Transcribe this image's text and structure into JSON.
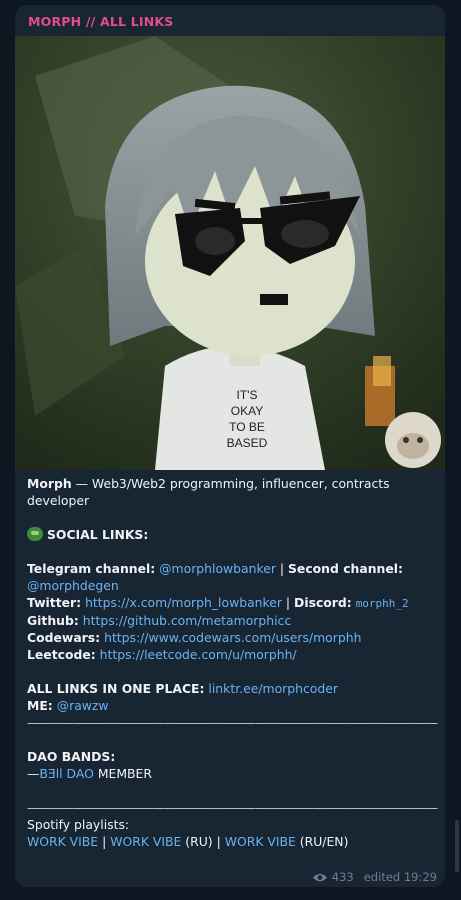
{
  "post": {
    "channel_title": "MORPH // ALL LINKS",
    "image_shirt_lines": [
      "IT'S",
      "OKAY",
      "TO BE",
      "BASED"
    ],
    "intro_name": "Morph",
    "intro_text": " — Web3/Web2 programming, influencer, contracts developer",
    "social_header": "SOCIAL LINKS:",
    "telegram_label": "Telegram channel:",
    "telegram_handle": "@morphlowbanker",
    "sep": " | ",
    "second_label": "Second channel:",
    "second_handle": "@morphdegen",
    "twitter_label": "Twitter:",
    "twitter_url": "https://x.com/morph_lowbanker",
    "discord_label": "Discord:",
    "discord_handle": "morphh_2",
    "github_label": "Github:",
    "github_url": "https://github.com/metamorphicc",
    "codewars_label": "Codewars:",
    "codewars_url": "https://www.codewars.com/users/morphh",
    "leetcode_label": "Leetcode:",
    "leetcode_url": "https://leetcode.com/u/morphh/",
    "all_links_label": "ALL LINKS IN ONE PLACE:",
    "all_links_url": "linktr.ee/morphcoder",
    "me_label": "ME:",
    "me_handle": "@rawzw",
    "divider": "————————————————————————————————————",
    "dao_label": "DAO BANDS:",
    "dao_prefix": "—",
    "dao_link": "BƎll DAO",
    "dao_suffix": " MEMBER",
    "spotify_label": "Spotify playlists:",
    "playlist1": "WORK VIBE",
    "playlist2": "WORK VIBE",
    "playlist2_suffix": " (RU)",
    "playlist3": "WORK VIBE",
    "playlist3_suffix": " (RU/EN)",
    "views": "433",
    "edited": "edited 19:29"
  },
  "icons": {
    "eye": "eye-icon",
    "emoji": "pepe-emoji-icon",
    "avatar": "cat-avatar-icon"
  },
  "colors": {
    "background": "#0e1621",
    "bubble": "#182533",
    "channel_title": "#e64b8a",
    "link": "#6ab3f3",
    "text": "#f1f3f5",
    "meta": "#6d7f8f"
  }
}
